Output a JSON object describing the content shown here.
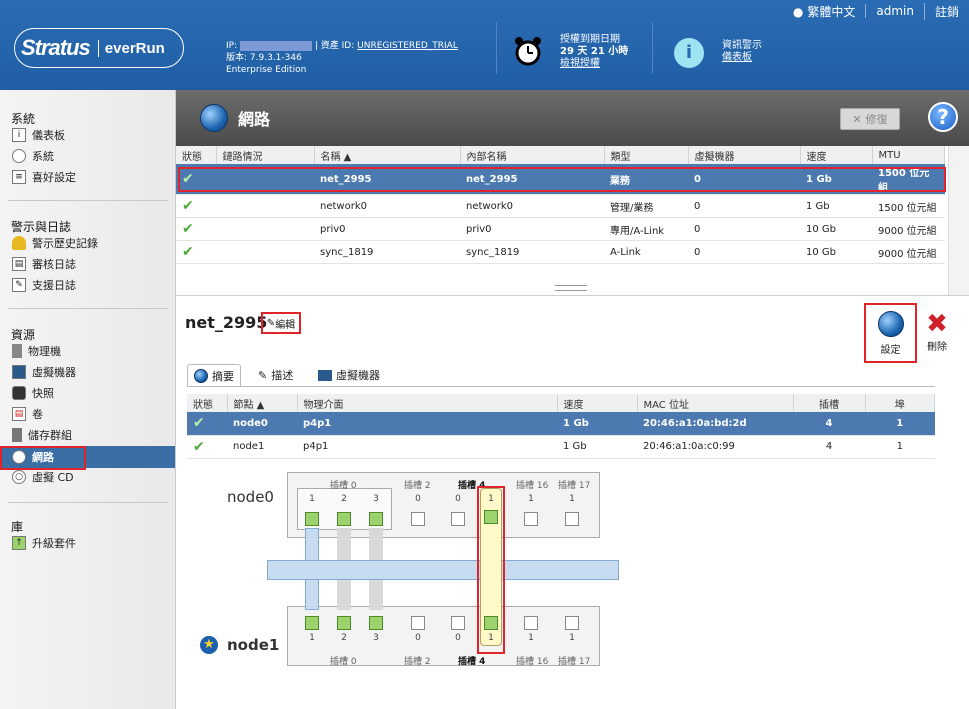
{
  "header": {
    "brand_main": "Stratus",
    "brand_sub": "everRun",
    "ip_label": "IP:",
    "asset_label": "| 資產 ID:",
    "asset_value": "UNREGISTERED_TRIAL",
    "version": "版本: 7.9.3.1-346",
    "edition": "Enterprise Edition",
    "license_title": "授權到期日期",
    "license_remaining": "29 天 21 小時",
    "license_link": "檢視授權",
    "alerts_title": "資訊警示",
    "alerts_link": "儀表板",
    "lang": "繁體中文",
    "user": "admin",
    "logout": "註銷"
  },
  "sidebar": {
    "sections": [
      {
        "title": "系統",
        "items": [
          {
            "label": "儀表板",
            "icon": "dashboard-icon"
          },
          {
            "label": "系統",
            "icon": "system-icon"
          },
          {
            "label": "喜好設定",
            "icon": "preferences-icon"
          }
        ]
      },
      {
        "title": "警示與日誌",
        "items": [
          {
            "label": "警示歷史記錄",
            "icon": "bell-icon"
          },
          {
            "label": "審核日誌",
            "icon": "audit-log-icon"
          },
          {
            "label": "支援日誌",
            "icon": "support-log-icon"
          }
        ]
      },
      {
        "title": "資源",
        "items": [
          {
            "label": "物理機",
            "icon": "server-icon"
          },
          {
            "label": "虛擬機器",
            "icon": "vm-icon"
          },
          {
            "label": "快照",
            "icon": "camera-icon"
          },
          {
            "label": "卷",
            "icon": "volume-icon"
          },
          {
            "label": "儲存群組",
            "icon": "storage-icon"
          },
          {
            "label": "網路",
            "icon": "globe-icon"
          },
          {
            "label": "虛擬 CD",
            "icon": "cd-icon"
          }
        ]
      },
      {
        "title": "庫",
        "items": [
          {
            "label": "升級套件",
            "icon": "upgrade-icon"
          }
        ]
      }
    ]
  },
  "page": {
    "title": "網路",
    "repair_label": "修復",
    "help_label": "?"
  },
  "networks": {
    "columns": [
      "狀態",
      "鏈路情況",
      "名稱 ▲",
      "內部名稱",
      "類型",
      "虛擬機器",
      "速度",
      "MTU"
    ],
    "rows": [
      {
        "name": "net_2995",
        "internal": "net_2995",
        "type": "業務",
        "vms": "0",
        "speed": "1 Gb",
        "mtu": "1500 位元組"
      },
      {
        "name": "network0",
        "internal": "network0",
        "type": "管理/業務",
        "vms": "0",
        "speed": "1 Gb",
        "mtu": "1500 位元組"
      },
      {
        "name": "priv0",
        "internal": "priv0",
        "type": "專用/A-Link",
        "vms": "0",
        "speed": "10 Gb",
        "mtu": "9000 位元組"
      },
      {
        "name": "sync_1819",
        "internal": "sync_1819",
        "type": "A-Link",
        "vms": "0",
        "speed": "10 Gb",
        "mtu": "9000 位元組"
      }
    ]
  },
  "detail": {
    "name": "net_2995",
    "edit_label": "編輯",
    "settings_label": "設定",
    "delete_label": "刪除",
    "tabs": [
      "摘要",
      "描述",
      "虛擬機器"
    ],
    "port_columns": [
      "狀態",
      "節點 ▲",
      "物理介面",
      "速度",
      "MAC 位址",
      "插槽",
      "埠"
    ],
    "ports": [
      {
        "node": "node0",
        "iface": "p4p1",
        "speed": "1 Gb",
        "mac": "20:46:a1:0a:bd:2d",
        "slot": "4",
        "port": "1"
      },
      {
        "node": "node1",
        "iface": "p4p1",
        "speed": "1 Gb",
        "mac": "20:46:a1:0a:c0:99",
        "slot": "4",
        "port": "1"
      }
    ],
    "diagram": {
      "node0": "node0",
      "node1": "node1",
      "slot_labels": [
        "插槽 0",
        "插槽 2",
        "插槽 4",
        "插槽 16",
        "插槽 17"
      ],
      "port_nums": [
        "1",
        "2",
        "3",
        "0",
        "0",
        "1",
        "1",
        "1"
      ]
    }
  }
}
